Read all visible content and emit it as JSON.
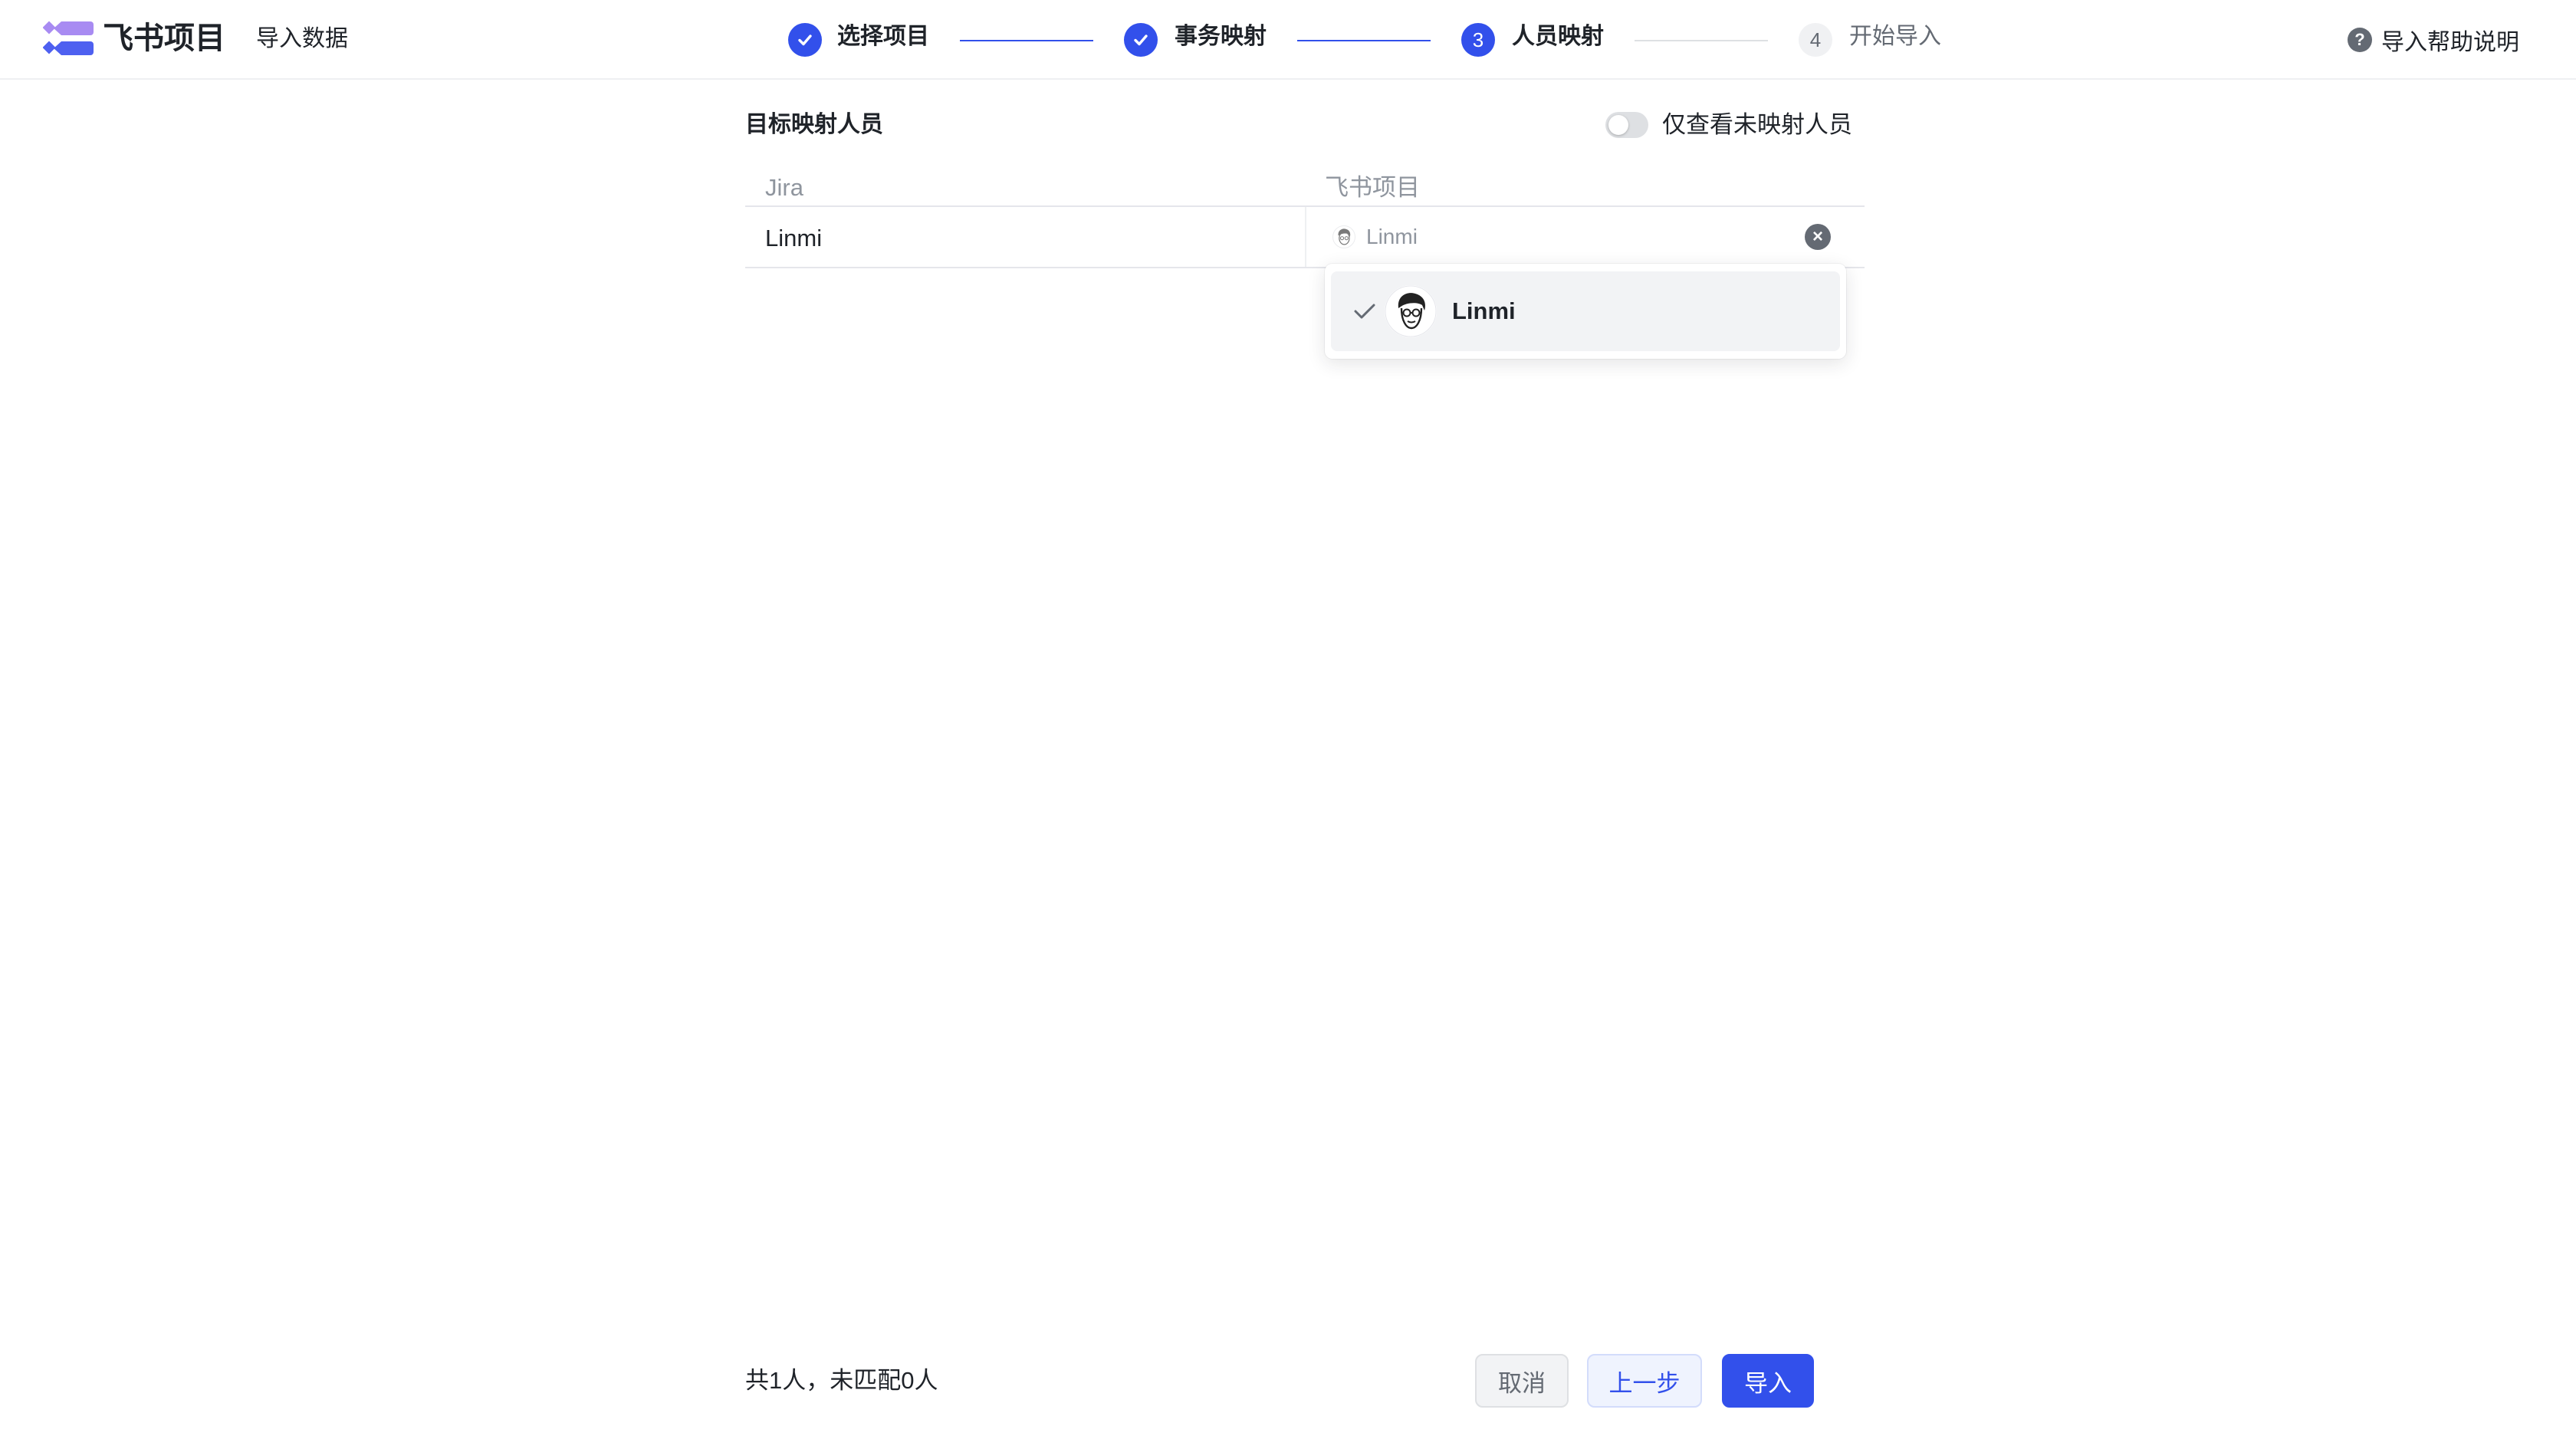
{
  "app": {
    "brand": "飞书项目",
    "subtitle": "导入数据"
  },
  "steps": [
    {
      "index": "1",
      "label": "选择项目",
      "state": "done"
    },
    {
      "index": "2",
      "label": "事务映射",
      "state": "done"
    },
    {
      "index": "3",
      "label": "人员映射",
      "state": "active"
    },
    {
      "index": "4",
      "label": "开始导入",
      "state": "todo"
    }
  ],
  "help": {
    "label": "导入帮助说明",
    "icon": "question-icon"
  },
  "mapping": {
    "title": "目标映射人员",
    "toggle": {
      "label": "仅查看未映射人员",
      "on": false
    },
    "columns": [
      "Jira",
      "飞书项目"
    ],
    "rows": [
      {
        "source": "Linmi",
        "target": "Linmi"
      }
    ],
    "dropdown": {
      "options": [
        {
          "name": "Linmi",
          "selected": true
        }
      ]
    }
  },
  "footer": {
    "summary": "共1人，未匹配0人",
    "cancel": "取消",
    "prev": "上一步",
    "import": "导入"
  },
  "colors": {
    "accent": "#3250eb",
    "text": "#1f2329",
    "muted": "#646a73",
    "border": "#e5e6eb"
  }
}
